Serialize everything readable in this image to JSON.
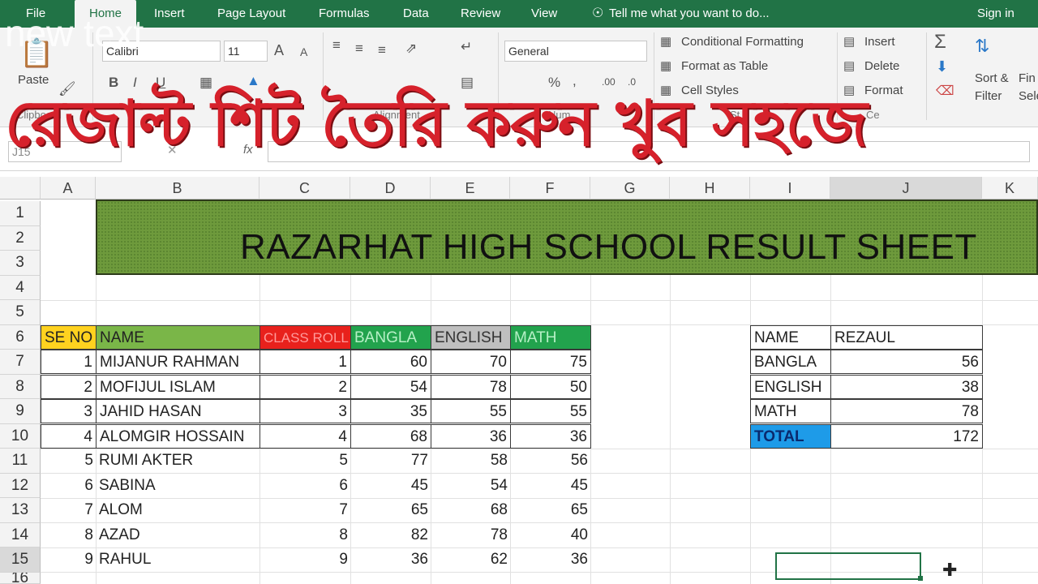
{
  "tabs": [
    {
      "label": "File"
    },
    {
      "label": "Home"
    },
    {
      "label": "Insert"
    },
    {
      "label": "Page Layout"
    },
    {
      "label": "Formulas"
    },
    {
      "label": "Data"
    },
    {
      "label": "Review"
    },
    {
      "label": "View"
    }
  ],
  "tell_me": "Tell me what you want to do...",
  "sign_in": "Sign in",
  "ribbon": {
    "paste": "Paste",
    "font_name": "Calibri",
    "font_size": "11",
    "number_format": "General",
    "conditional_formatting": "Conditional Formatting",
    "format_as_table": "Format as Table",
    "cell_styles": "Cell Styles",
    "insert": "Insert",
    "delete": "Delete",
    "format": "Format",
    "sort_filter_1": "Sort &",
    "sort_filter_2": "Filter",
    "find_1": "Fin",
    "find_2": "Sele",
    "clipboard_group": "Clipboard",
    "alignment_group": "Alignment",
    "number_group": "Num",
    "styles_group": "St",
    "cells_group": "Ce",
    "percent": "%",
    "comma": ",",
    "bold": "B",
    "italic": "I",
    "underline": "U",
    "font_grow": "A",
    "font_shrink": "A"
  },
  "formula_bar": {
    "name_box": "J15",
    "fx": "fx"
  },
  "overlay_text": "রেজাল্ট শিট তৈরি করুন খুব সহজে",
  "watermark": "new text",
  "columns": [
    "A",
    "B",
    "C",
    "D",
    "E",
    "F",
    "G",
    "H",
    "I",
    "J",
    "K"
  ],
  "rows": [
    "1",
    "2",
    "3",
    "4",
    "5",
    "6",
    "7",
    "8",
    "9",
    "10",
    "11",
    "12",
    "13",
    "14",
    "15",
    "16"
  ],
  "banner_title": "RAZARHAT HIGH SCHOOL RESULT SHEET",
  "table_headers": {
    "se_no": "SE NO",
    "name": "NAME",
    "class_roll": "CLASS ROLL",
    "bangla": "BANGLA",
    "english": "ENGLISH",
    "math": "MATH"
  },
  "header_colors": {
    "se_no": "#ffd21f",
    "name": "#7ab648",
    "class_roll": "#e8211c",
    "bangla": "#22a34d",
    "english": "#bfbfbf",
    "math": "#22a34d"
  },
  "students": [
    {
      "se": "1",
      "name": "MIJANUR RAHMAN",
      "roll": "1",
      "bangla": "60",
      "english": "70",
      "math": "75"
    },
    {
      "se": "2",
      "name": "MOFIJUL ISLAM",
      "roll": "2",
      "bangla": "54",
      "english": "78",
      "math": "50"
    },
    {
      "se": "3",
      "name": "JAHID HASAN",
      "roll": "3",
      "bangla": "35",
      "english": "55",
      "math": "55"
    },
    {
      "se": "4",
      "name": "ALOMGIR HOSSAIN",
      "roll": "4",
      "bangla": "68",
      "english": "36",
      "math": "36"
    },
    {
      "se": "5",
      "name": "RUMI AKTER",
      "roll": "5",
      "bangla": "77",
      "english": "58",
      "math": "56"
    },
    {
      "se": "6",
      "name": "SABINA",
      "roll": "6",
      "bangla": "45",
      "english": "54",
      "math": "45"
    },
    {
      "se": "7",
      "name": "ALOM",
      "roll": "7",
      "bangla": "65",
      "english": "68",
      "math": "65"
    },
    {
      "se": "8",
      "name": "AZAD",
      "roll": "8",
      "bangla": "82",
      "english": "78",
      "math": "40"
    },
    {
      "se": "9",
      "name": "RAHUL",
      "roll": "9",
      "bangla": "36",
      "english": "62",
      "math": "36"
    }
  ],
  "lookup": {
    "name_label": "NAME",
    "name_value": "REZAUL",
    "bangla_label": "BANGLA",
    "bangla_value": "56",
    "english_label": "ENGLISH",
    "english_value": "38",
    "math_label": "MATH",
    "math_value": "78",
    "total_label": "TOTAL",
    "total_value": "172",
    "total_color": "#1e9be8"
  }
}
